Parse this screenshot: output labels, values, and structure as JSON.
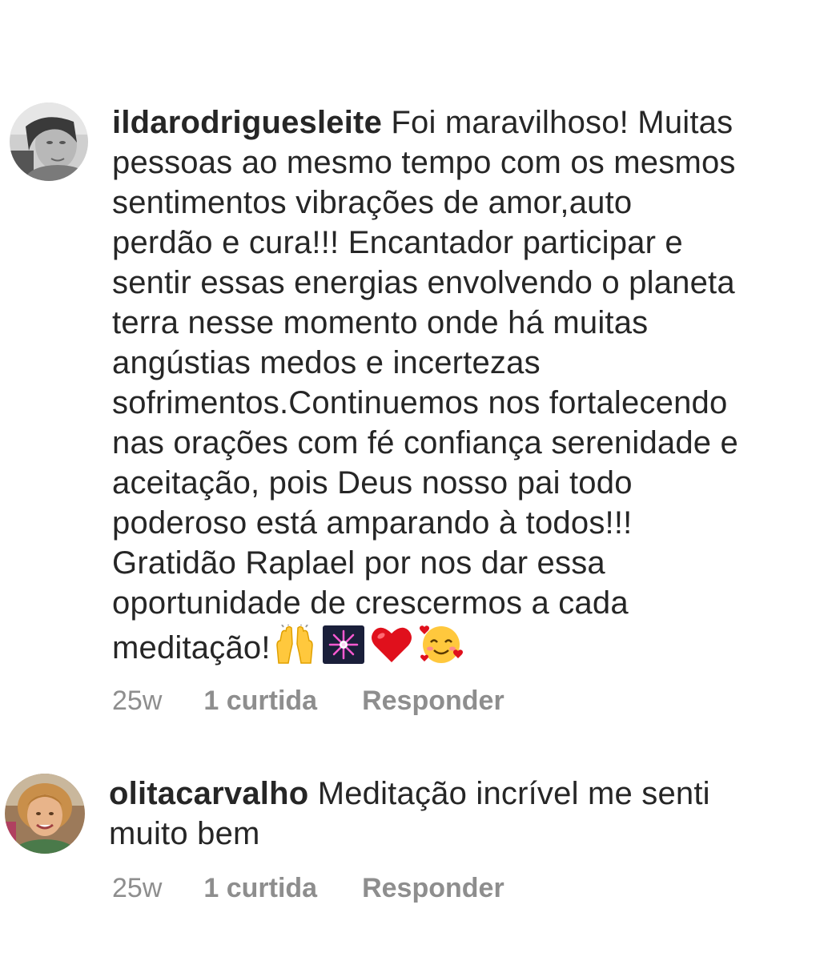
{
  "comments": [
    {
      "username": "ildarodriguesleite",
      "lines": [
        "Foi maravilhoso! Muitas",
        "pessoas ao mesmo tempo com os mesmos",
        "sentimentos vibrações de amor,auto",
        "perdão e cura!!! Encantador participar e",
        "sentir essas energias envolvendo o planeta",
        "terra nesse momento onde há muitas",
        "angústias medos e incertezas",
        "sofrimentos.Continuemos nos fortalecendo",
        "nas orações com fé confiança serenidade e",
        "aceitação, pois Deus nosso pai todo",
        "poderoso está amparando à todos!!!",
        "Gratidão Raplael  por nos dar essa",
        "oportunidade de crescermos a cada",
        "meditação!"
      ],
      "emojis": [
        "raising-hands-emoji",
        "fireworks-emoji",
        "red-heart-emoji",
        "smiling-face-with-hearts-emoji"
      ],
      "time": "25w",
      "likes": "1 curtida",
      "reply": "Responder"
    },
    {
      "username": "olitacarvalho",
      "lines": [
        "Meditação incrível me senti",
        "muito bem"
      ],
      "time": "25w",
      "likes": "1 curtida",
      "reply": "Responder"
    }
  ]
}
